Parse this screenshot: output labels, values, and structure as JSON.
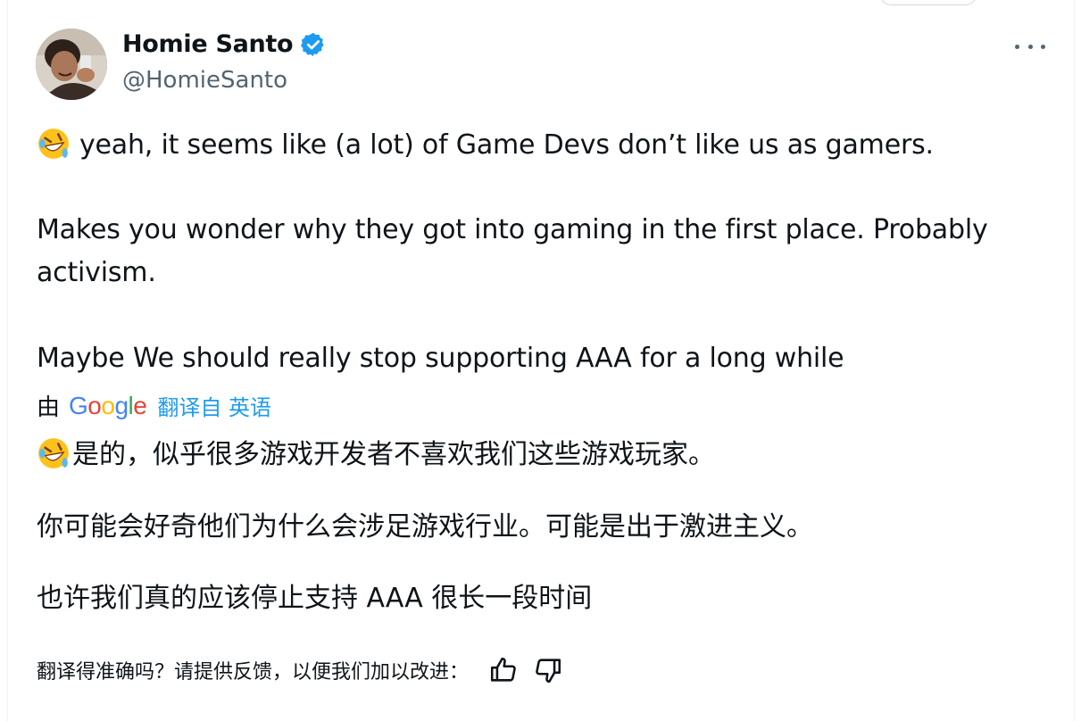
{
  "author": {
    "display_name": "Homie Santo",
    "handle": "@HomieSanto",
    "verified": true,
    "verified_color": "#1d9bf0"
  },
  "tweet": {
    "emoji": "rolling-on-floor-laughing",
    "line1": "yeah, it seems like (a lot) of Game Devs don’t like us as gamers.",
    "line2a": "Makes you wonder why they got into gaming in the first place. Probably",
    "line2b": "activism.",
    "line3": "Maybe We should really stop supporting AAA for a long while"
  },
  "translation": {
    "by_label": "由",
    "provider": "Google",
    "link_label": "翻译自 英语",
    "zh_line1": "是的，似乎很多游戏开发者不喜欢我们这些游戏玩家。",
    "zh_line2": "你可能会好奇他们为什么会涉足游戏行业。可能是出于激进主义。",
    "zh_line3": "也许我们真的应该停止支持 AAA 很长一段时间",
    "feedback_prompt": "翻译得准确吗？请提供反馈，以便我们加以改进：",
    "link_color": "#1d9bf0"
  },
  "icons": {
    "more": "more-horizontal-icon",
    "thumbs_up": "thumbs-up-icon",
    "thumbs_down": "thumbs-down-icon"
  }
}
